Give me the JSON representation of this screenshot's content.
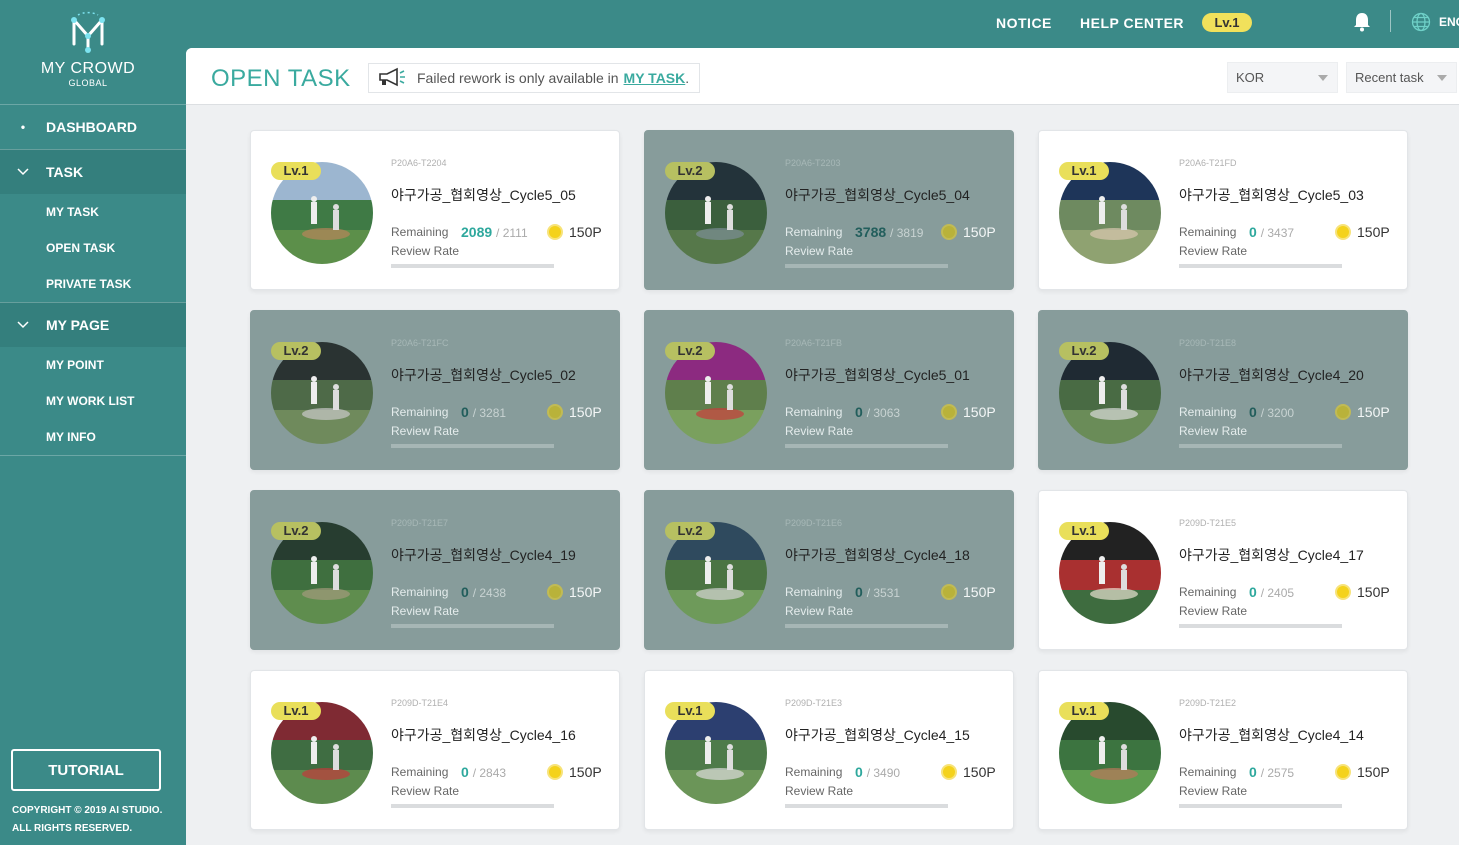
{
  "brand": {
    "title": "MY CROWD",
    "subtitle": "GLOBAL"
  },
  "nav": {
    "dashboard": "DASHBOARD",
    "task": "TASK",
    "task_items": [
      "MY TASK",
      "OPEN TASK",
      "PRIVATE TASK"
    ],
    "mypage": "MY PAGE",
    "mypage_items": [
      "MY POINT",
      "MY WORK LIST",
      "MY INFO"
    ]
  },
  "sidebar_footer": {
    "tutorial": "TUTORIAL",
    "copyright_line1": "COPYRIGHT © 2019 AI STUDIO.",
    "copyright_line2": "ALL RIGHTS RESERVED."
  },
  "topbar": {
    "notice": "NOTICE",
    "help_center": "HELP CENTER",
    "level": "Lv.1",
    "language": "ENG",
    "bell_icon": "bell-icon",
    "globe_icon": "globe-icon"
  },
  "header": {
    "title": "OPEN TASK",
    "notice_text": "Failed rework is only available in",
    "notice_link": "MY TASK",
    "notice_end": ".",
    "language_select": "KOR",
    "sort_select": "Recent task"
  },
  "labels": {
    "remaining": "Remaining",
    "review_rate": "Review Rate"
  },
  "colors": {
    "accent": "#3aaa9f",
    "sidebar": "#3b8a88",
    "level_badge": "#e9df5a"
  },
  "tasks": [
    {
      "level": "Lv.1",
      "code": "P20A6-T2204",
      "name": "야구가공_협회영상_Cycle5_05",
      "remaining": "2089",
      "total": "/ 2111",
      "points": "150P",
      "dim": false,
      "review_rate": 0
    },
    {
      "level": "Lv.2",
      "code": "P20A6-T2203",
      "name": "야구가공_협회영상_Cycle5_04",
      "remaining": "3788",
      "total": "/ 3819",
      "points": "150P",
      "dim": true,
      "review_rate": 0
    },
    {
      "level": "Lv.1",
      "code": "P20A6-T21FD",
      "name": "야구가공_협회영상_Cycle5_03",
      "remaining": "0",
      "total": "/ 3437",
      "points": "150P",
      "dim": false,
      "review_rate": 0
    },
    {
      "level": "Lv.2",
      "code": "P20A6-T21FC",
      "name": "야구가공_협회영상_Cycle5_02",
      "remaining": "0",
      "total": "/ 3281",
      "points": "150P",
      "dim": true,
      "review_rate": 0
    },
    {
      "level": "Lv.2",
      "code": "P20A6-T21FB",
      "name": "야구가공_협회영상_Cycle5_01",
      "remaining": "0",
      "total": "/ 3063",
      "points": "150P",
      "dim": true,
      "review_rate": 0
    },
    {
      "level": "Lv.2",
      "code": "P209D-T21E8",
      "name": "야구가공_협회영상_Cycle4_20",
      "remaining": "0",
      "total": "/ 3200",
      "points": "150P",
      "dim": true,
      "review_rate": 0
    },
    {
      "level": "Lv.2",
      "code": "P209D-T21E7",
      "name": "야구가공_협회영상_Cycle4_19",
      "remaining": "0",
      "total": "/ 2438",
      "points": "150P",
      "dim": true,
      "review_rate": 0
    },
    {
      "level": "Lv.2",
      "code": "P209D-T21E6",
      "name": "야구가공_협회영상_Cycle4_18",
      "remaining": "0",
      "total": "/ 3531",
      "points": "150P",
      "dim": true,
      "review_rate": 0
    },
    {
      "level": "Lv.1",
      "code": "P209D-T21E5",
      "name": "야구가공_협회영상_Cycle4_17",
      "remaining": "0",
      "total": "/ 2405",
      "points": "150P",
      "dim": false,
      "review_rate": 0
    },
    {
      "level": "Lv.1",
      "code": "P209D-T21E4",
      "name": "야구가공_협회영상_Cycle4_16",
      "remaining": "0",
      "total": "/ 2843",
      "points": "150P",
      "dim": false,
      "review_rate": 0
    },
    {
      "level": "Lv.1",
      "code": "P209D-T21E3",
      "name": "야구가공_협회영상_Cycle4_15",
      "remaining": "0",
      "total": "/ 3490",
      "points": "150P",
      "dim": false,
      "review_rate": 0
    },
    {
      "level": "Lv.1",
      "code": "P209D-T21E2",
      "name": "야구가공_협회영상_Cycle4_14",
      "remaining": "0",
      "total": "/ 2575",
      "points": "150P",
      "dim": false,
      "review_rate": 0
    }
  ]
}
